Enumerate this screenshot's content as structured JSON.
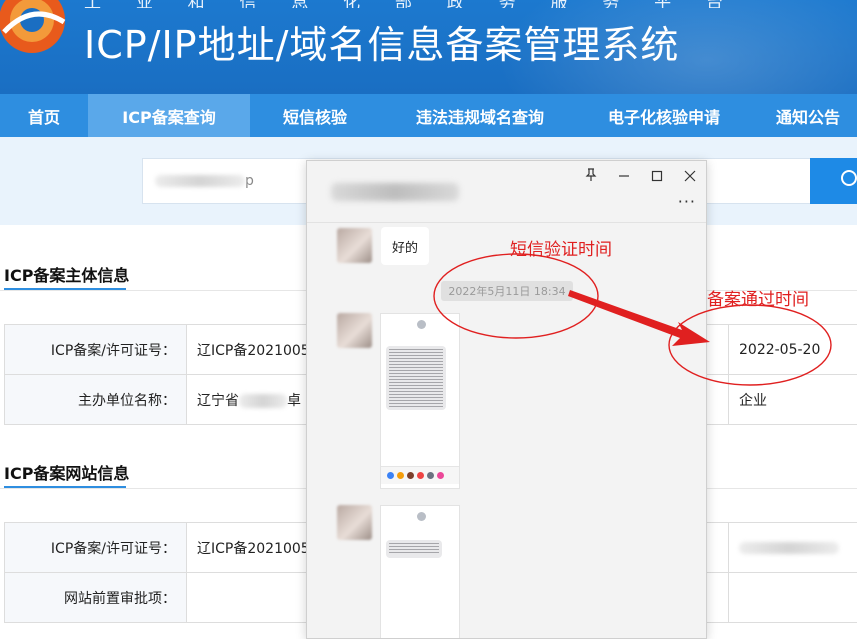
{
  "header": {
    "subtitle_chars": [
      "工",
      "业",
      "和",
      "信",
      "息",
      "化",
      "部",
      "政",
      "务",
      "服",
      "务",
      "平",
      "台"
    ],
    "title": "ICP/IP地址/域名信息备案管理系统"
  },
  "nav": {
    "items": [
      {
        "label": "首页",
        "active": false
      },
      {
        "label": "ICP备案查询",
        "active": true
      },
      {
        "label": "短信核验",
        "active": false
      },
      {
        "label": "违法违规域名查询",
        "active": false
      },
      {
        "label": "电子化核验申请",
        "active": false
      },
      {
        "label": "通知公告",
        "active": false
      }
    ]
  },
  "search": {
    "value_visible_suffix": "p",
    "button_icon": "search-icon"
  },
  "sections": {
    "subject": {
      "title": "ICP备案主体信息",
      "rows": [
        {
          "label": "ICP备案/许可证号：",
          "value": "辽ICP备2021005",
          "right_value": "2022-05-20"
        },
        {
          "label": "主办单位名称：",
          "value": "辽宁省",
          "value_tail": "卓",
          "right_value": "企业"
        }
      ]
    },
    "website": {
      "title": "ICP备案网站信息",
      "rows": [
        {
          "label": "ICP备案/许可证号：",
          "value": "辽ICP备2021005"
        },
        {
          "label": "网站前置审批项：",
          "value": ""
        }
      ]
    }
  },
  "chat": {
    "window_controls": {
      "pin": "pin-icon",
      "minimize": "minimize-icon",
      "maximize": "maximize-icon",
      "close": "close-icon"
    },
    "more_label": "···",
    "reply_text": "好的",
    "timestamp": "2022年5月11日 18:34"
  },
  "annotations": {
    "sms_time_label": "短信验证时间",
    "approval_time_label": "备案通过时间",
    "color": "#e02020"
  },
  "colors": {
    "header_bg": "#1a6ec2",
    "nav_bg": "#2e8ee0",
    "nav_active": "#5aa8ea",
    "search_band": "#e9f3fc",
    "search_button": "#1e8ae6"
  }
}
